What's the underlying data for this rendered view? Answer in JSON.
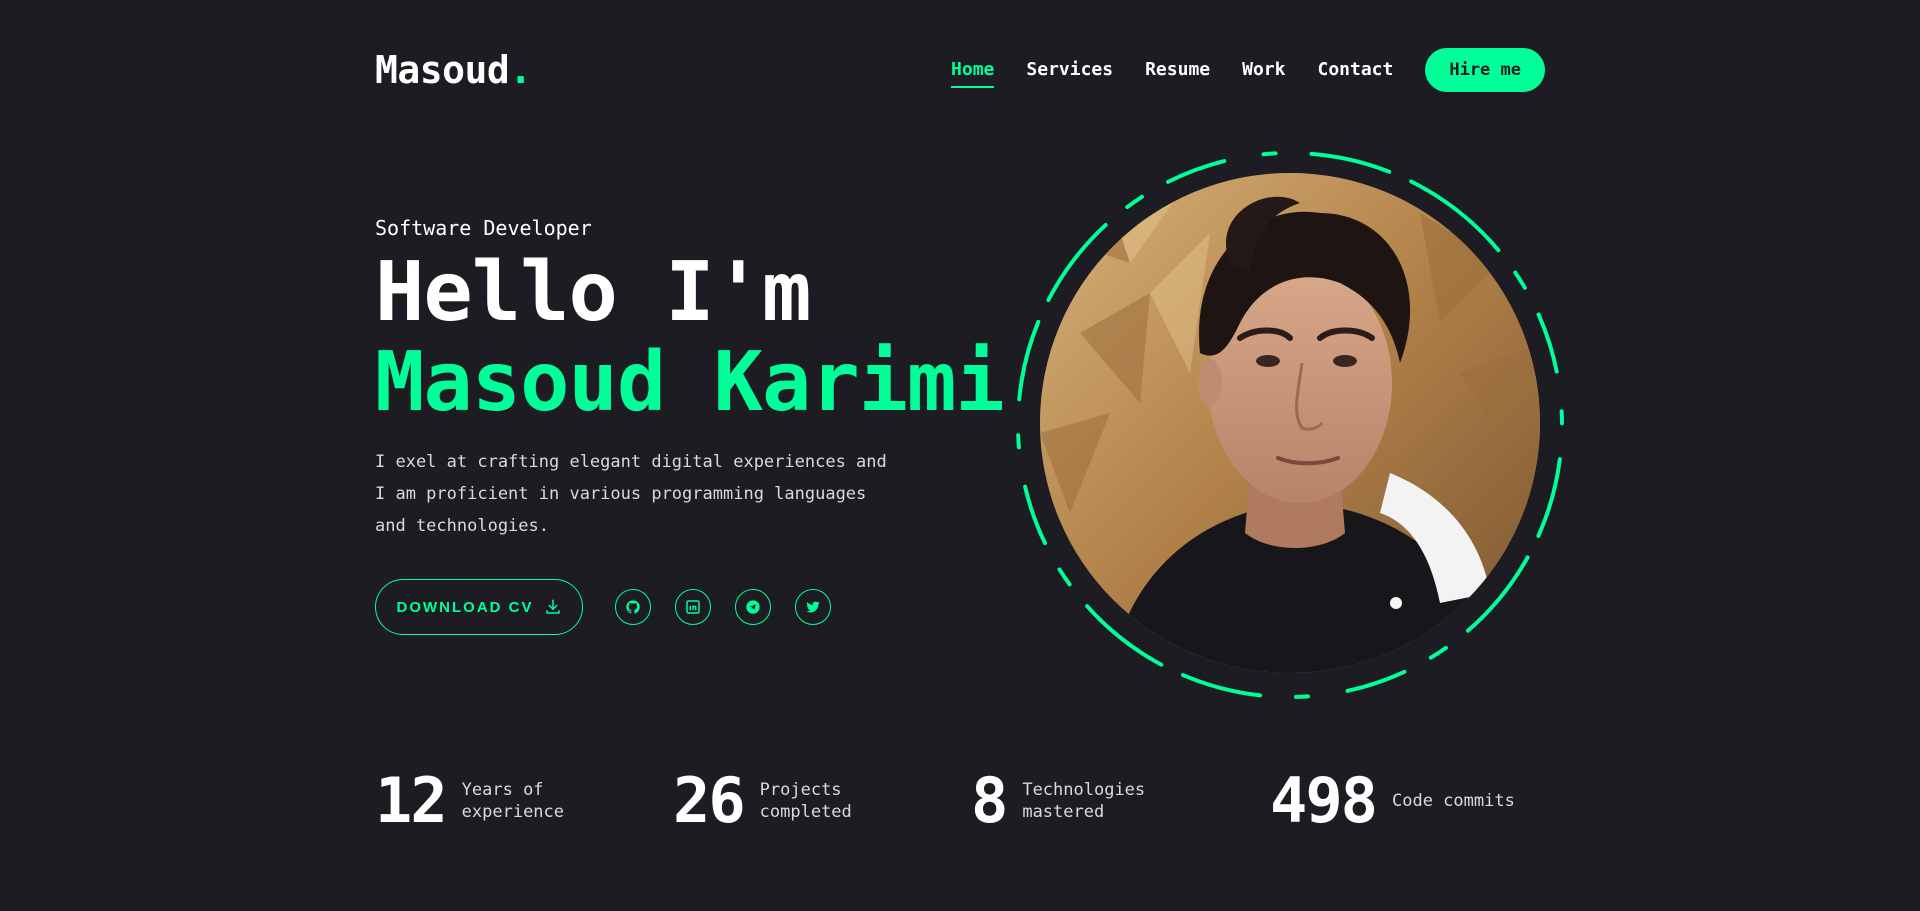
{
  "header": {
    "logo_text": "Masoud",
    "logo_dot": ".",
    "nav": [
      {
        "label": "Home",
        "active": true
      },
      {
        "label": "Services",
        "active": false
      },
      {
        "label": "Resume",
        "active": false
      },
      {
        "label": "Work",
        "active": false
      },
      {
        "label": "Contact",
        "active": false
      }
    ],
    "cta_label": "Hire me"
  },
  "hero": {
    "subtitle": "Software Developer",
    "greeting": "Hello I'm",
    "name": "Masoud Karimi",
    "description": "I exel at crafting elegant digital experiences and I am proficient in various programming languages and technologies.",
    "download_label": "DOWNLOAD CV",
    "socials": [
      {
        "icon": "github-icon"
      },
      {
        "icon": "linkedin-icon"
      },
      {
        "icon": "telegram-icon"
      },
      {
        "icon": "twitter-icon"
      }
    ]
  },
  "stats": [
    {
      "value": "12",
      "label": "Years of experience"
    },
    {
      "value": "26",
      "label": "Projects completed"
    },
    {
      "value": "8",
      "label": "Technologies mastered"
    },
    {
      "value": "498",
      "label": "Code commits"
    }
  ],
  "colors": {
    "background": "#1c1c22",
    "accent": "#00ff99",
    "text": "#ffffff"
  }
}
